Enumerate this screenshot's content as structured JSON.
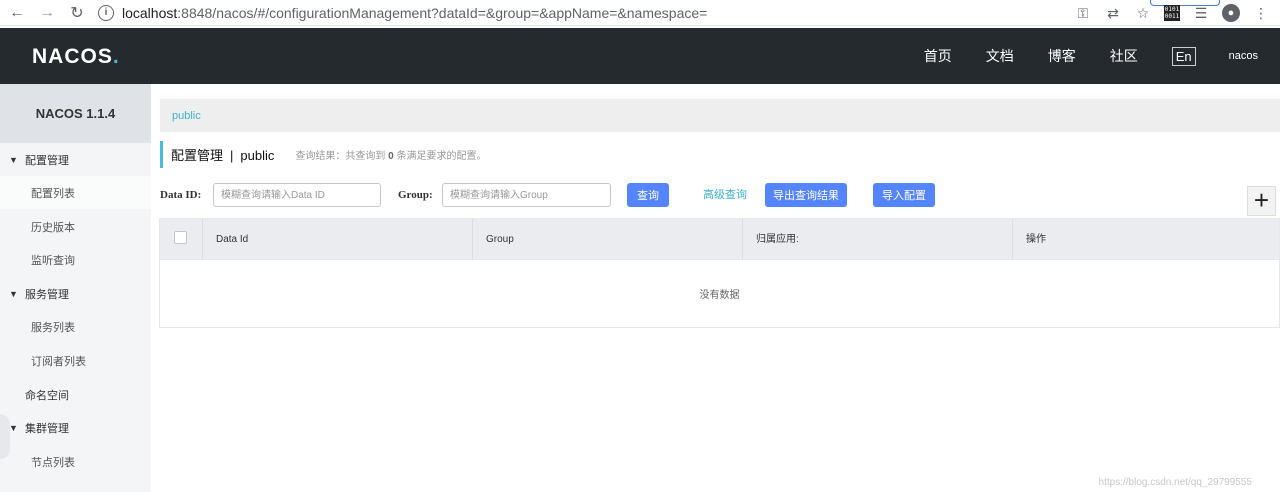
{
  "browser": {
    "url_host": "localhost",
    "url_rest": ":8848/nacos/#/configurationManagement?dataId=&group=&appName=&namespace=",
    "ext_text": "0101\n0011"
  },
  "header": {
    "logo_main": "NACOS",
    "logo_dot": ".",
    "nav": [
      "首页",
      "文档",
      "博客",
      "社区"
    ],
    "lang": "En",
    "user": "nacos"
  },
  "sidebar": {
    "version": "NACOS 1.1.4",
    "config_group": "配置管理",
    "config_items": [
      "配置列表",
      "历史版本",
      "监听查询"
    ],
    "service_group": "服务管理",
    "service_items": [
      "服务列表",
      "订阅者列表"
    ],
    "namespace": "命名空间",
    "cluster_group": "集群管理",
    "cluster_items": [
      "节点列表"
    ]
  },
  "breadcrumb": "public",
  "title": {
    "main": "配置管理",
    "sep": "|",
    "namespace": "public",
    "result_prefix": "查询结果：共查询到 ",
    "result_count": "0",
    "result_suffix": " 条满足要求的配置。"
  },
  "search": {
    "dataid_label": "Data ID:",
    "dataid_placeholder": "模糊查询请输入Data ID",
    "group_label": "Group:",
    "group_placeholder": "模糊查询请输入Group",
    "query_btn": "查询",
    "advanced_link": "高级查询",
    "export_btn": "导出查询结果",
    "import_btn": "导入配置",
    "add_symbol": "+"
  },
  "table": {
    "headers": [
      "Data Id",
      "Group",
      "归属应用:",
      "操作"
    ],
    "empty_text": "没有数据"
  },
  "watermark": "https://blog.csdn.net/qq_29799555",
  "colors": {
    "header_bg": "#252a2f",
    "accent": "#46bcd9",
    "primary_button": "#5584ff",
    "sidebar_bg": "#f4f5f7"
  }
}
